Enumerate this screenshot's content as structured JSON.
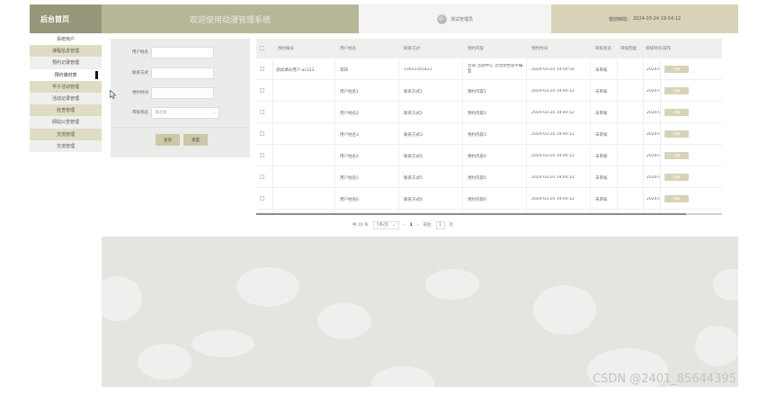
{
  "header": {
    "logo": "后台首页",
    "welcome": "欢迎使用动漫管理系统",
    "user": "测试管理员",
    "time_label": "當前時間：",
    "time_value": "2024-03-24 19:54:12"
  },
  "sidebar": {
    "items": [
      {
        "label": "系统用户"
      },
      {
        "label": "课程信息管理"
      },
      {
        "label": "预约记录管理"
      },
      {
        "label": "预约课时表"
      },
      {
        "label": "学子活动管理"
      },
      {
        "label": "活动记录管理"
      },
      {
        "label": "检查管理"
      },
      {
        "label": "网站公告管理"
      },
      {
        "label": "交流管理"
      },
      {
        "label": "交流管理"
      }
    ]
  },
  "search": {
    "fields": [
      {
        "label": "用户姓名",
        "value": ""
      },
      {
        "label": "联系方式",
        "value": ""
      },
      {
        "label": "预约时间",
        "value": ""
      }
    ],
    "status_label": "审核状态",
    "status_placeholder": "请选择",
    "query_button": "查询",
    "reset_button": "重置"
  },
  "table": {
    "columns": [
      "预约账号",
      "用户姓名",
      "联系方式",
      "预约内容",
      "预约时间",
      "审核状态",
      "审核回复",
      "审核时间",
      "操作"
    ],
    "rows": [
      {
        "account": "测试课长用户-ac123",
        "name": "李四",
        "phone": "13652165421",
        "content": "咨询 活动中心 活动文档等平编型",
        "time": "2024-03-24 19:50:50",
        "status": "未审核",
        "reply": "",
        "audit_time": "2024-0",
        "action": "详情"
      },
      {
        "account": "",
        "name": "用户姓名1",
        "phone": "联系方式1",
        "content": "预约内容1",
        "time": "2024-03-24 19:44:12",
        "status": "未审核",
        "reply": "",
        "audit_time": "2024-0",
        "action": "详情"
      },
      {
        "account": "",
        "name": "用户姓名2",
        "phone": "联系方式2",
        "content": "预约内容2",
        "time": "2024-03-24 19:44:12",
        "status": "未审核",
        "reply": "",
        "audit_time": "2024-0",
        "action": "详情"
      },
      {
        "account": "",
        "name": "用户姓名3",
        "phone": "联系方式3",
        "content": "预约内容3",
        "time": "2024-03-24 19:44:12",
        "status": "未审核",
        "reply": "",
        "audit_time": "2024-0",
        "action": "详情"
      },
      {
        "account": "",
        "name": "用户姓名4",
        "phone": "联系方式4",
        "content": "预约内容4",
        "time": "2024-03-24 19:44:12",
        "status": "未审核",
        "reply": "",
        "audit_time": "2024-0",
        "action": "详情"
      },
      {
        "account": "",
        "name": "用户姓名5",
        "phone": "联系方式5",
        "content": "预约内容5",
        "time": "2024-03-24 19:44:12",
        "status": "未审核",
        "reply": "",
        "audit_time": "2024-0",
        "action": "详情"
      },
      {
        "account": "",
        "name": "用户姓名6",
        "phone": "联系方式6",
        "content": "预约内容6",
        "time": "2024-03-24 19:44:12",
        "status": "未审核",
        "reply": "",
        "audit_time": "2024-0",
        "action": "详情"
      }
    ]
  },
  "pagination": {
    "total": "共 10 条",
    "page_size": "7条/页",
    "current_page": "1",
    "goto_label": "前往",
    "goto_value": "1",
    "page_suffix": "页"
  },
  "watermark": "CSDN @2401_85644395",
  "colors": {
    "accent": "#cdc7a8",
    "header_dark": "#97977b",
    "header_mid": "#b7b798",
    "header_light": "#d8d3b8",
    "background": "#e4e4e1"
  }
}
